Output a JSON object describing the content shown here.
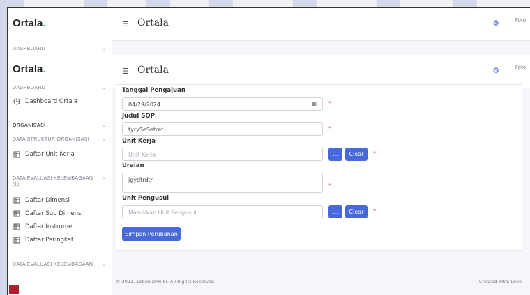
{
  "app": {
    "logo": "Ortala",
    "logo_dot": "."
  },
  "header": {
    "title": "Ortala",
    "avatar_alt": "Foto"
  },
  "sidebar": {
    "dashboard_section": "DASHBOARD",
    "dashboard_item": "Dashboard Ortala",
    "organisasi_section": "ORGANISASI",
    "struktur_section": "DATA STRUKTUR ORGANISASI",
    "unit_kerja_item": "Daftar Unit Kerja",
    "evaluasi_section": "DATA EVALUASI KELEMBAGAAN",
    "evaluasi_section_sub": "(1)",
    "evaluasi_items": [
      "Daftar Dimensi",
      "Daftar Sub Dimensi",
      "Daftar Instrumen",
      "Daftar Peringkat"
    ],
    "evaluasi_section_2": "DATA EVALUASI KELEMBAGAAN"
  },
  "form": {
    "tanggal_label": "Tanggal Pengajuan",
    "tanggal_value": "04/29/2024",
    "judul_label": "Judul SOP",
    "judul_value": "tyrySeSetret",
    "unit_kerja_label": "Unit Kerja",
    "unit_kerja_placeholder": "Unit Kerja",
    "uraian_label": "Uraian",
    "uraian_value": "jgydtrdtr",
    "pengusul_label": "Unit Pengusul",
    "pengusul_placeholder": "Masukkan Unit Pengusul",
    "browse_label": "...",
    "clear_label": "Clear",
    "required_mark": "*",
    "submit_label": "Simpan Perubahan"
  },
  "footer": {
    "copyright": "© 2023. Setjen DPR RI. All Rights Reserved.",
    "credit": "Created with: Love"
  },
  "colors": {
    "accent": "#4769d9",
    "required": "#e44d5b",
    "logo_dot": "#3ec5a6",
    "stripe": "#d3d9e8"
  }
}
